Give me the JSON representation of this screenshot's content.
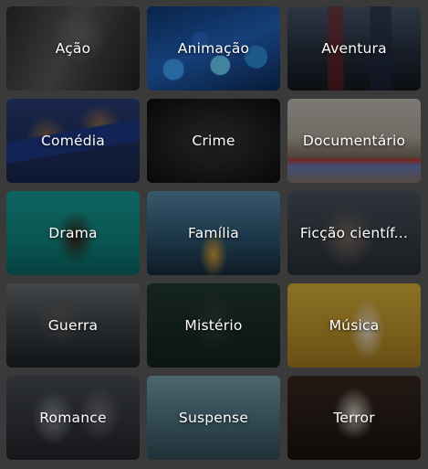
{
  "genres": [
    {
      "label": "Ação",
      "art": "bg-acao"
    },
    {
      "label": "Animação",
      "art": "bg-animacao"
    },
    {
      "label": "Aventura",
      "art": "bg-aventura"
    },
    {
      "label": "Comédia",
      "art": "bg-comedia"
    },
    {
      "label": "Crime",
      "art": "bg-crime"
    },
    {
      "label": "Documentário",
      "art": "bg-documentario"
    },
    {
      "label": "Drama",
      "art": "bg-drama"
    },
    {
      "label": "Família",
      "art": "bg-familia"
    },
    {
      "label": "Ficção científ...",
      "art": "bg-ficcao"
    },
    {
      "label": "Guerra",
      "art": "bg-guerra"
    },
    {
      "label": "Mistério",
      "art": "bg-misterio"
    },
    {
      "label": "Música",
      "art": "bg-musica"
    },
    {
      "label": "Romance",
      "art": "bg-romance"
    },
    {
      "label": "Suspense",
      "art": "bg-suspense"
    },
    {
      "label": "Terror",
      "art": "bg-terror"
    }
  ],
  "colors": {
    "background": "#3a3a3a",
    "label_text": "#ffffff"
  }
}
